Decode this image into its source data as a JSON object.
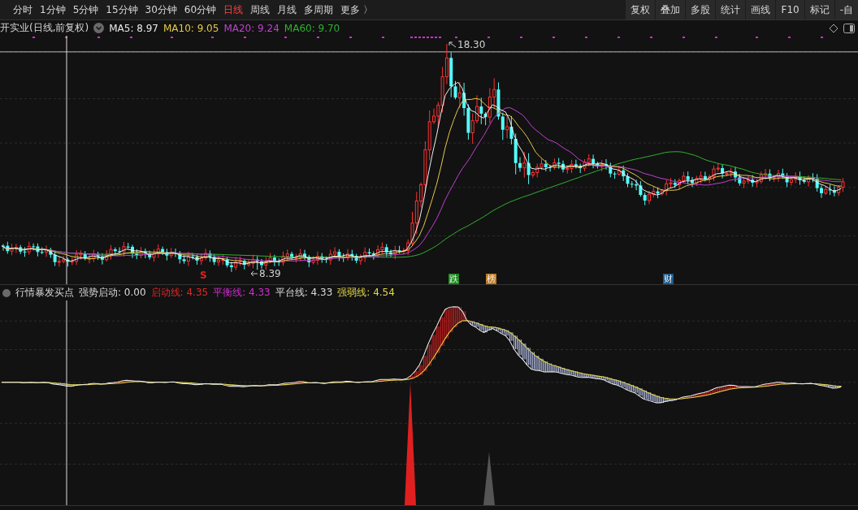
{
  "toolbar": {
    "tabs": [
      {
        "label": "分时",
        "selected": false
      },
      {
        "label": "1分钟",
        "selected": false
      },
      {
        "label": "5分钟",
        "selected": false
      },
      {
        "label": "15分钟",
        "selected": false
      },
      {
        "label": "30分钟",
        "selected": false
      },
      {
        "label": "60分钟",
        "selected": false
      },
      {
        "label": "日线",
        "selected": true
      },
      {
        "label": "周线",
        "selected": false
      },
      {
        "label": "月线",
        "selected": false
      },
      {
        "label": "多周期",
        "selected": false
      },
      {
        "label": "更多 〉",
        "selected": false
      }
    ],
    "buttons": [
      "复权",
      "叠加",
      "多股",
      "统计",
      "画线",
      "F10",
      "标记",
      "-自"
    ]
  },
  "legend": {
    "title": "开实业(日线,前复权)",
    "averages": [
      {
        "label": "MA5: 8.97",
        "color": "#e8e8e8"
      },
      {
        "label": "MA10: 9.05",
        "color": "#e6c84a"
      },
      {
        "label": "MA20: 9.24",
        "color": "#c040d0"
      },
      {
        "label": "MA60: 9.70",
        "color": "#30b030"
      }
    ]
  },
  "price_chart": {
    "high_label": "18.30",
    "low_label": "8.39",
    "markers": [
      {
        "kind": "signal",
        "text": "S",
        "color": "#e02020"
      },
      {
        "kind": "badge",
        "text": "跌",
        "color": "#1a8a1a"
      },
      {
        "kind": "badge",
        "text": "榜",
        "color": "#c07a20"
      },
      {
        "kind": "badge",
        "text": "财",
        "color": "#1a5a8a"
      }
    ]
  },
  "indicator": {
    "name": "行情暴发买点",
    "values": [
      {
        "label": "强势启动: 0.00",
        "color": "#dcdcdc"
      },
      {
        "label": "启动线: 4.35",
        "color": "#e02828"
      },
      {
        "label": "平衡线: 4.33",
        "color": "#d030d0"
      },
      {
        "label": "平台线: 4.33",
        "color": "#dcdcdc"
      },
      {
        "label": "强弱线: 4.54",
        "color": "#e6d84a"
      }
    ]
  }
}
